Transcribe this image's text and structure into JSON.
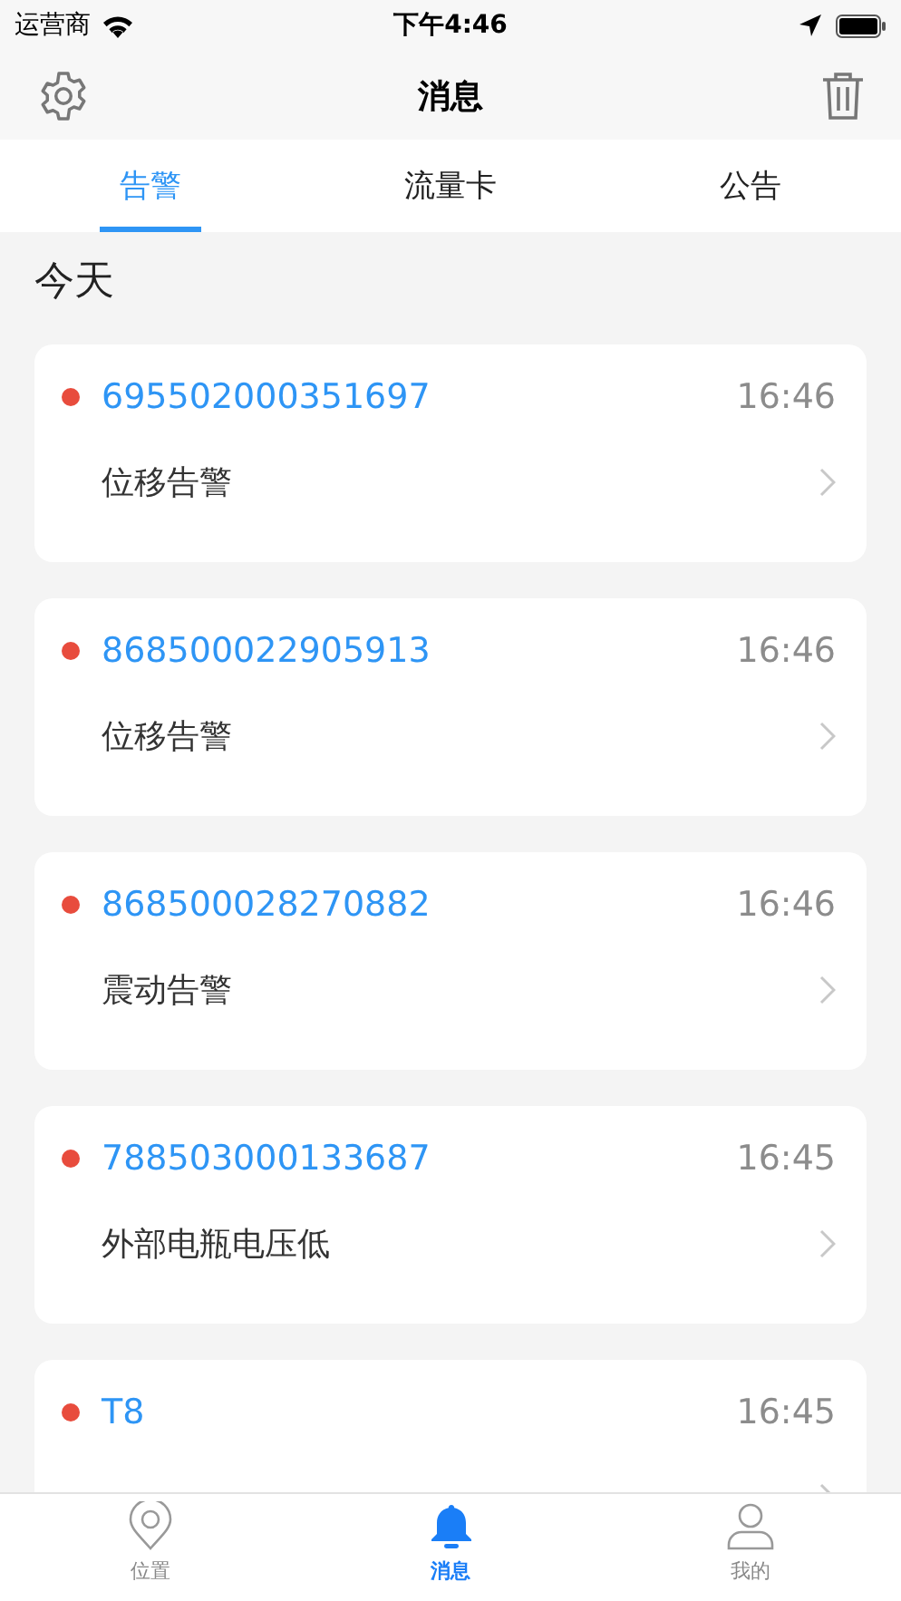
{
  "status_bar": {
    "carrier": "运营商",
    "time": "下午4:46"
  },
  "nav_bar": {
    "title": "消息"
  },
  "tabs": [
    {
      "label": "告警",
      "selected": true
    },
    {
      "label": "流量卡",
      "selected": false
    },
    {
      "label": "公告",
      "selected": false
    }
  ],
  "section_title": "今天",
  "messages": [
    {
      "device": "695502000351697",
      "time": "16:46",
      "text": "位移告警",
      "unread": true
    },
    {
      "device": "868500022905913",
      "time": "16:46",
      "text": "位移告警",
      "unread": true
    },
    {
      "device": "868500028270882",
      "time": "16:46",
      "text": "震动告警",
      "unread": true
    },
    {
      "device": "788503000133687",
      "time": "16:45",
      "text": "外部电瓶电压低",
      "unread": true
    },
    {
      "device": "T8",
      "time": "16:45",
      "unread": true
    }
  ],
  "tab_bar": [
    {
      "label": "位置",
      "selected": false
    },
    {
      "label": "消息",
      "selected": true
    },
    {
      "label": "我的",
      "selected": false
    }
  ]
}
